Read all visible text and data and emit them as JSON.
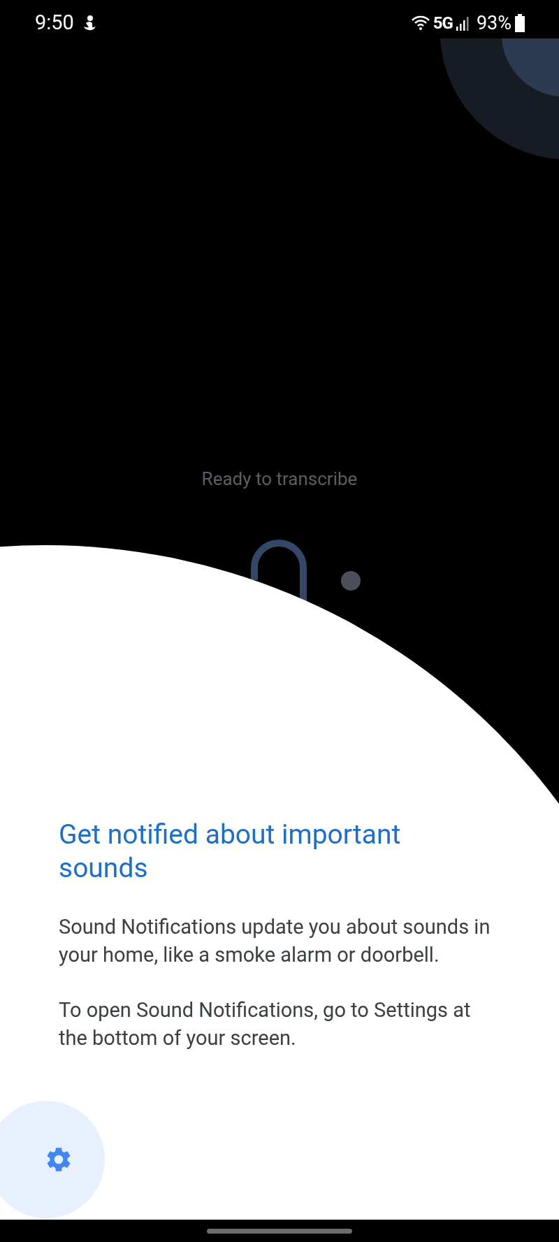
{
  "status_bar": {
    "time": "9:50",
    "network": "5G",
    "battery": "93%"
  },
  "transcribe_status": "Ready to transcribe",
  "onboarding": {
    "title": "Get notified about important sounds",
    "paragraphs": [
      "Sound Notifications update you about sounds in your home, like a smoke alarm or doorbell.",
      "To open Sound Notifications, go to Settings at the bottom of your screen."
    ]
  }
}
